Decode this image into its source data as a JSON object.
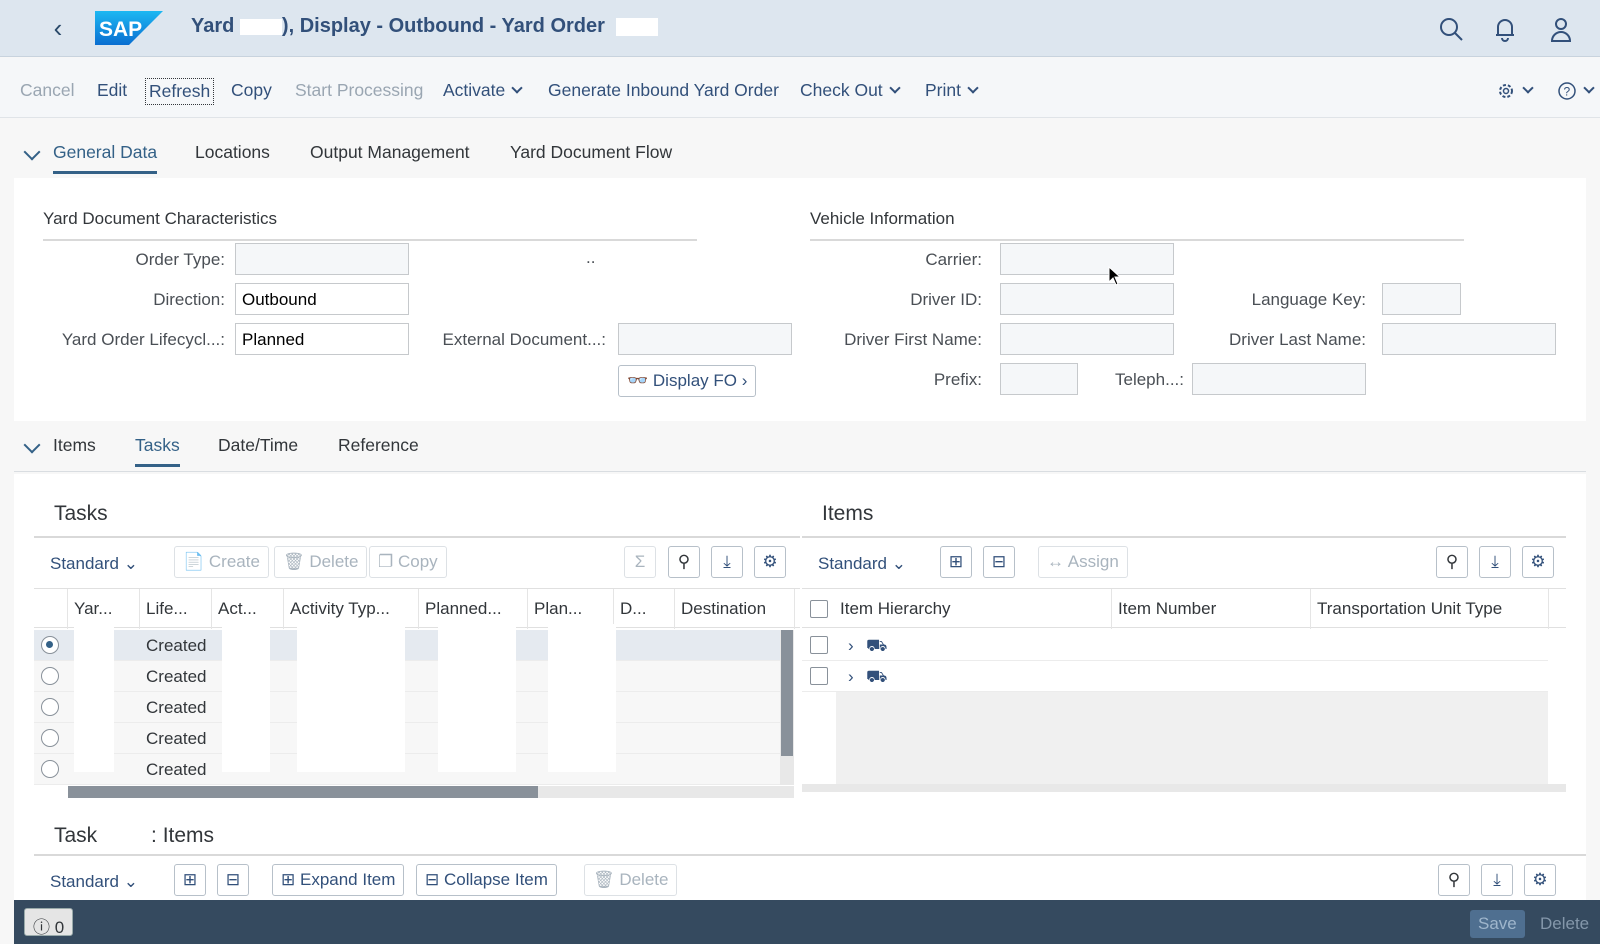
{
  "shell": {
    "title_prefix": "Yard",
    "title_main": "), Display - Outbound - Yard Order"
  },
  "toolbar": {
    "cancel": "Cancel",
    "edit": "Edit",
    "refresh": "Refresh",
    "copy": "Copy",
    "start_processing": "Start Processing",
    "activate": "Activate",
    "generate_inbound": "Generate Inbound Yard Order",
    "check_out": "Check Out",
    "print": "Print"
  },
  "section1_tabs": [
    "General Data",
    "Locations",
    "Output Management",
    "Yard Document Flow"
  ],
  "characteristics": {
    "title": "Yard Document Characteristics",
    "order_type_label": "Order Type:",
    "order_type_value": "",
    "order_type_suffix": "..",
    "direction_label": "Direction:",
    "direction_value": "Outbound",
    "lifecycle_label": "Yard Order Lifecycl...:",
    "lifecycle_value": "Planned",
    "external_doc_label": "External Document...:",
    "external_doc_value": "",
    "display_fo": "Display FO"
  },
  "vehicle": {
    "title": "Vehicle Information",
    "carrier_label": "Carrier:",
    "driver_id_label": "Driver ID:",
    "language_key_label": "Language Key:",
    "driver_first_label": "Driver First Name:",
    "driver_last_label": "Driver Last Name:",
    "prefix_label": "Prefix:",
    "telephone_label": "Teleph...:"
  },
  "section2_tabs": [
    "Items",
    "Tasks",
    "Date/Time",
    "Reference"
  ],
  "tasks_panel": {
    "title": "Tasks",
    "variant": "Standard",
    "create": "Create",
    "delete": "Delete",
    "copy": "Copy",
    "columns": [
      "Yar...",
      "Life...",
      "Act...",
      "Activity Typ...",
      "Planned...",
      "Plan...",
      "D...",
      "Destination"
    ],
    "rows": [
      {
        "lifecycle": "Created",
        "selected": true
      },
      {
        "lifecycle": "Created",
        "selected": false
      },
      {
        "lifecycle": "Created",
        "selected": false
      },
      {
        "lifecycle": "Created",
        "selected": false
      },
      {
        "lifecycle": "Created",
        "selected": false
      }
    ]
  },
  "items_panel": {
    "title": "Items",
    "variant": "Standard",
    "assign": "Assign",
    "columns": [
      "Item Hierarchy",
      "Item Number",
      "Transportation Unit Type"
    ],
    "rows": [
      {
        "icon": "truck-icon"
      },
      {
        "icon": "vehicle-icon"
      }
    ]
  },
  "task_items": {
    "title_prefix": "Task",
    "title_suffix": ": Items",
    "variant": "Standard",
    "expand": "Expand Item",
    "collapse": "Collapse Item",
    "delete": "Delete"
  },
  "footer": {
    "message_count": "0",
    "save": "Save",
    "delete": "Delete"
  }
}
